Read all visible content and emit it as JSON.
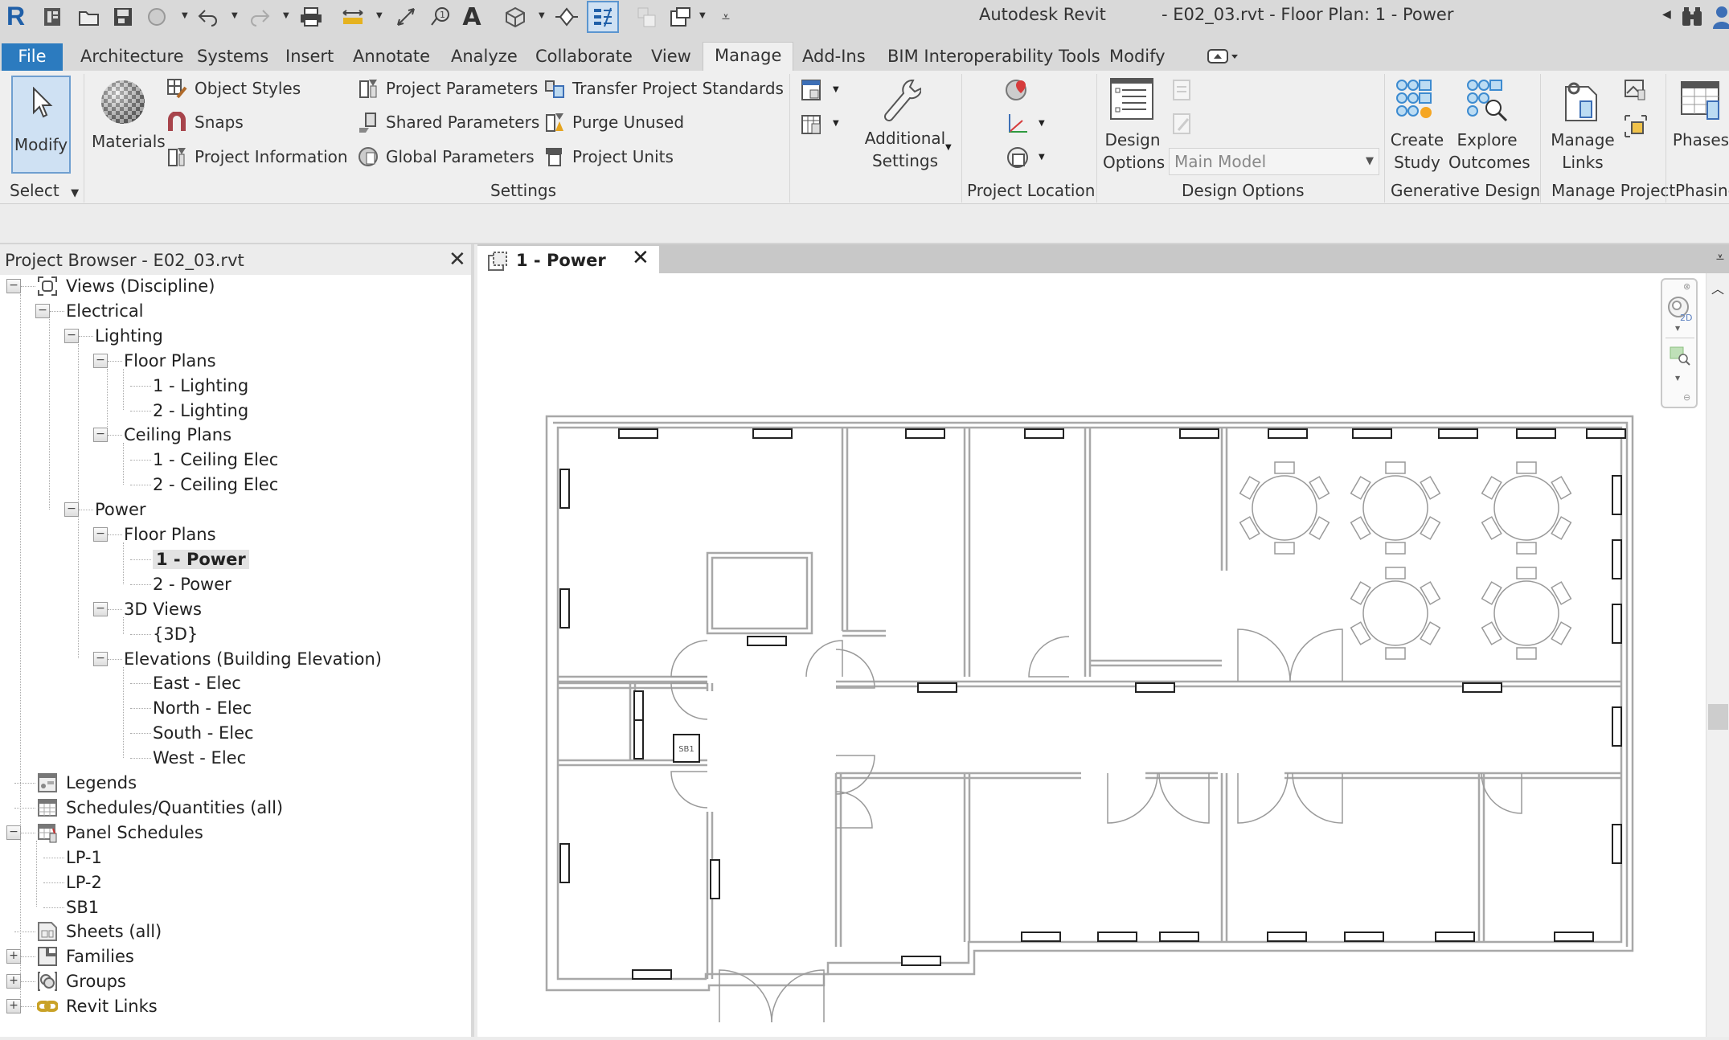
{
  "app": {
    "name": "Autodesk Revit",
    "document_title": "- E02_03.rvt - Floor Plan: 1 - Power"
  },
  "quick_access": [
    {
      "name": "app-logo",
      "glyph": "R"
    },
    {
      "name": "home-icon"
    },
    {
      "name": "open-icon"
    },
    {
      "name": "save-icon"
    },
    {
      "name": "sync-icon"
    },
    {
      "name": "undo-icon"
    },
    {
      "name": "redo-icon"
    },
    {
      "name": "print-icon"
    },
    {
      "name": "measure-icon"
    },
    {
      "name": "aligned-dimension-icon"
    },
    {
      "name": "tag-icon"
    },
    {
      "name": "text-icon",
      "glyph": "A"
    },
    {
      "name": "3d-view-icon"
    },
    {
      "name": "section-icon"
    },
    {
      "name": "thin-lines-icon"
    },
    {
      "name": "close-hidden-icon"
    },
    {
      "name": "switch-windows-icon"
    },
    {
      "name": "customize-qat-icon"
    }
  ],
  "tabs": {
    "file": "File",
    "items": [
      "Architecture",
      "Systems",
      "Insert",
      "Annotate",
      "Analyze",
      "Collaborate",
      "View",
      "Manage",
      "Add-Ins",
      "BIM Interoperability Tools",
      "Modify"
    ],
    "active": "Manage"
  },
  "ribbon": {
    "select": {
      "modify": "Modify",
      "label": "Select"
    },
    "settings": {
      "label": "Settings",
      "materials": "Materials",
      "object_styles": "Object  Styles",
      "snaps": "Snaps",
      "project_information": "Project  Information",
      "project_parameters": "Project  Parameters",
      "shared_parameters": "Shared  Parameters",
      "global_parameters": "Global  Parameters",
      "transfer_standards": "Transfer  Project Standards",
      "purge_unused": "Purge  Unused",
      "project_units": "Project  Units",
      "additional_settings_1": "Additional",
      "additional_settings_2": "Settings"
    },
    "project_location": {
      "label": "Project Location"
    },
    "design_options": {
      "label": "Design Options",
      "button_1": "Design",
      "button_2": "Options",
      "selected_option": "Main Model"
    },
    "generative_design": {
      "label": "Generative Design",
      "create_1": "Create",
      "create_2": "Study",
      "explore_1": "Explore",
      "explore_2": "Outcomes"
    },
    "manage_project": {
      "label": "Manage Project",
      "links_1": "Manage",
      "links_2": "Links"
    },
    "phasing": {
      "label": "Phasing",
      "phases": "Phases"
    }
  },
  "project_browser": {
    "title": "Project Browser - E02_03.rvt",
    "tree": [
      {
        "label": "Views (Discipline)",
        "level": 0,
        "toggle": "minus",
        "icon": "views-icon"
      },
      {
        "label": "Electrical",
        "level": 1,
        "toggle": "minus"
      },
      {
        "label": "Lighting",
        "level": 2,
        "toggle": "minus"
      },
      {
        "label": "Floor Plans",
        "level": 3,
        "toggle": "minus"
      },
      {
        "label": "1 - Lighting",
        "level": 4
      },
      {
        "label": "2 - Lighting",
        "level": 4
      },
      {
        "label": "Ceiling Plans",
        "level": 3,
        "toggle": "minus"
      },
      {
        "label": "1 - Ceiling Elec",
        "level": 4
      },
      {
        "label": "2 - Ceiling Elec",
        "level": 4
      },
      {
        "label": "Power",
        "level": 2,
        "toggle": "minus"
      },
      {
        "label": "Floor Plans",
        "level": 3,
        "toggle": "minus"
      },
      {
        "label": "1 - Power",
        "level": 4,
        "selected": true
      },
      {
        "label": "2 - Power",
        "level": 4
      },
      {
        "label": "3D Views",
        "level": 3,
        "toggle": "minus"
      },
      {
        "label": "{3D}",
        "level": 4
      },
      {
        "label": "Elevations (Building Elevation)",
        "level": 3,
        "toggle": "minus"
      },
      {
        "label": "East - Elec",
        "level": 4
      },
      {
        "label": "North - Elec",
        "level": 4
      },
      {
        "label": "South - Elec",
        "level": 4
      },
      {
        "label": "West - Elec",
        "level": 4
      },
      {
        "label": "Legends",
        "level": 0,
        "icon": "legends-icon"
      },
      {
        "label": "Schedules/Quantities (all)",
        "level": 0,
        "icon": "schedules-icon"
      },
      {
        "label": "Panel Schedules",
        "level": 0,
        "toggle": "minus",
        "icon": "panel-schedules-icon"
      },
      {
        "label": "LP-1",
        "level": 1
      },
      {
        "label": "LP-2",
        "level": 1
      },
      {
        "label": "SB1",
        "level": 1
      },
      {
        "label": "Sheets (all)",
        "level": 0,
        "icon": "sheets-icon"
      },
      {
        "label": "Families",
        "level": 0,
        "toggle": "plus",
        "icon": "families-icon"
      },
      {
        "label": "Groups",
        "level": 0,
        "toggle": "plus",
        "icon": "groups-icon"
      },
      {
        "label": "Revit Links",
        "level": 0,
        "toggle": "plus",
        "icon": "revit-links-icon"
      }
    ]
  },
  "view": {
    "tab_label": "1 - Power",
    "panel_tag": "SB1",
    "nav_bar_badge": "2D"
  },
  "colors": {
    "file_tab": "#2c7bbf",
    "modify_active": "#cfe1f3",
    "wall": "#a8a8a8",
    "device": "#222222"
  }
}
